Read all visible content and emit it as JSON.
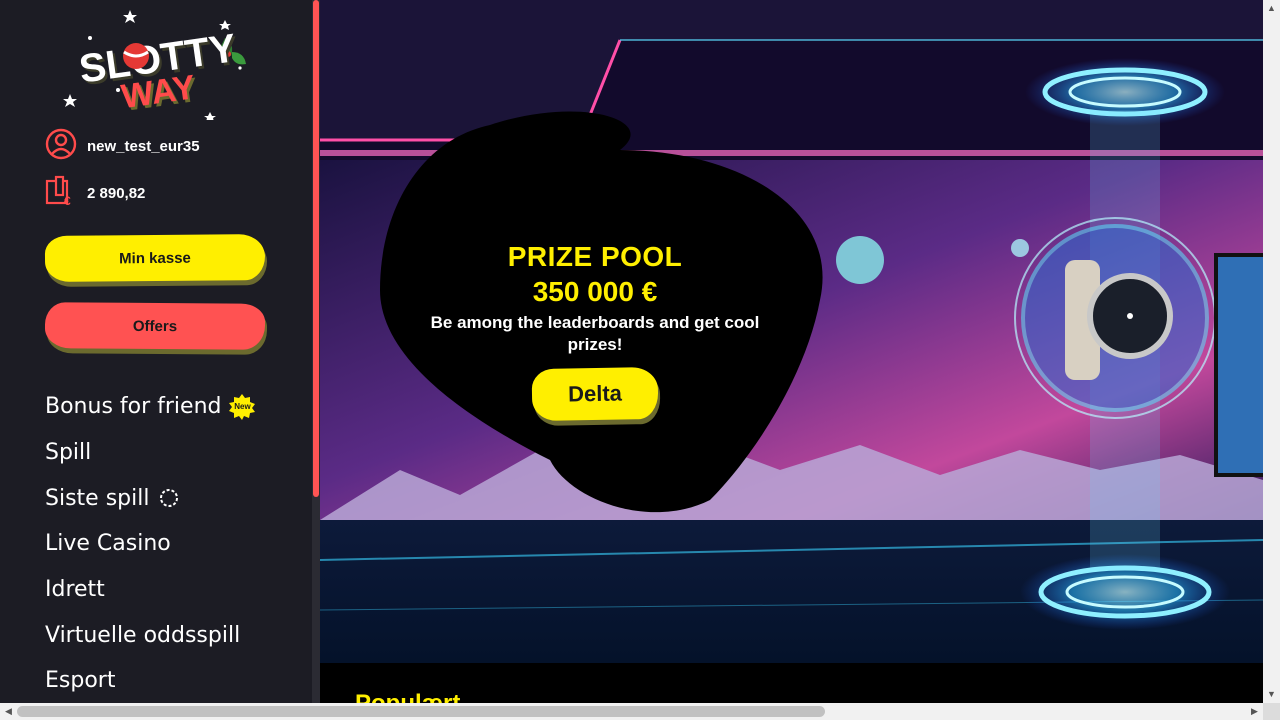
{
  "logo": {
    "text_top": "SLOTTY",
    "text_bottom": "WAY"
  },
  "account": {
    "username": "new_test_eur35",
    "balance": "2 890,82",
    "user_icon": "user-circle-icon",
    "wallet_icon": "wallet-euro-icon"
  },
  "buttons": {
    "cashier": "Min kasse",
    "offers": "Offers"
  },
  "nav": {
    "items": [
      {
        "label": "Bonus for friend",
        "badge": "New"
      },
      {
        "label": "Spill"
      },
      {
        "label": "Siste spill"
      },
      {
        "label": "Live Casino"
      },
      {
        "label": "Idrett"
      },
      {
        "label": "Virtuelle oddsspill"
      },
      {
        "label": "Esport"
      }
    ]
  },
  "banner": {
    "title": "PRIZE POOL",
    "amount": "350 000 €",
    "description": "Be among the leaderboards and get cool prizes!",
    "cta": "Delta"
  },
  "section": {
    "title": "Populært"
  },
  "colors": {
    "accent_yellow": "#ffef00",
    "accent_red": "#ff5252",
    "sidebar_bg": "#1c1c24"
  }
}
